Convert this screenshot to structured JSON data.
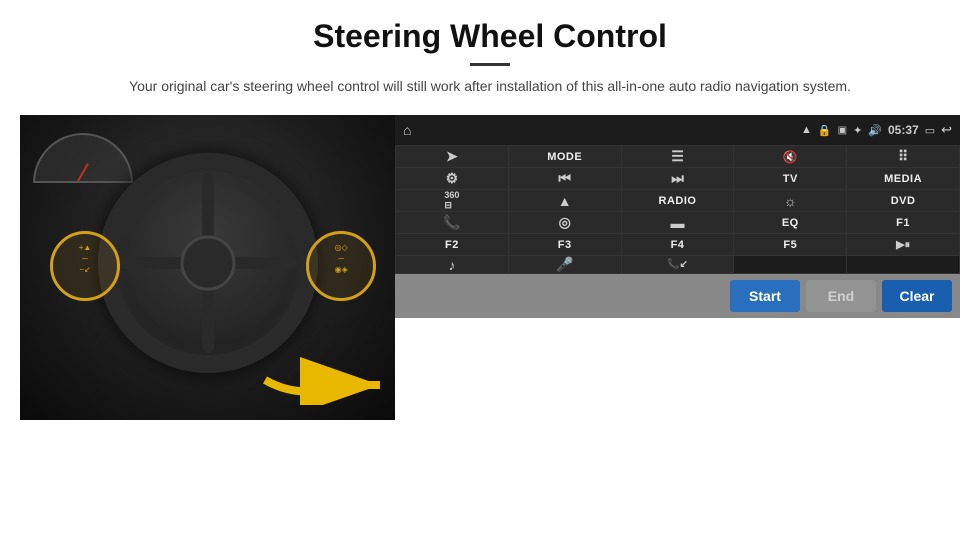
{
  "page": {
    "title": "Steering Wheel Control",
    "divider": true,
    "subtitle": "Your original car's steering wheel control will still work after installation of this all-in-one auto radio navigation system."
  },
  "android_ui": {
    "status_bar": {
      "time": "05:37",
      "icons": [
        "wifi",
        "lock",
        "sd-card",
        "bluetooth",
        "volume",
        "back",
        "home"
      ]
    },
    "grid_cells": [
      {
        "id": "r1c1",
        "type": "icon",
        "icon": "⊏",
        "label": "nav-icon"
      },
      {
        "id": "r1c2",
        "type": "text",
        "text": "MODE"
      },
      {
        "id": "r1c3",
        "type": "icon",
        "icon": "☰",
        "label": "list-icon"
      },
      {
        "id": "r1c4",
        "type": "icon",
        "icon": "🔇",
        "label": "mute-icon"
      },
      {
        "id": "r1c5",
        "type": "icon",
        "icon": "⠿",
        "label": "apps-icon"
      },
      {
        "id": "r2c1",
        "type": "icon",
        "icon": "⚙",
        "label": "settings-icon"
      },
      {
        "id": "r2c2",
        "type": "icon",
        "icon": "⏮",
        "label": "prev-icon"
      },
      {
        "id": "r2c3",
        "type": "icon",
        "icon": "⏭",
        "label": "next-icon"
      },
      {
        "id": "r2c4",
        "type": "text",
        "text": "TV"
      },
      {
        "id": "r2c5",
        "type": "text",
        "text": "MEDIA"
      },
      {
        "id": "r3c1",
        "type": "icon",
        "icon": "360",
        "label": "360-icon"
      },
      {
        "id": "r3c2",
        "type": "icon",
        "icon": "▲",
        "label": "eject-icon"
      },
      {
        "id": "r3c3",
        "type": "text",
        "text": "RADIO"
      },
      {
        "id": "r3c4",
        "type": "icon",
        "icon": "☼",
        "label": "brightness-icon"
      },
      {
        "id": "r3c5",
        "type": "text",
        "text": "DVD"
      },
      {
        "id": "r4c1",
        "type": "icon",
        "icon": "📞",
        "label": "phone-icon"
      },
      {
        "id": "r4c2",
        "type": "icon",
        "icon": "◎",
        "label": "compass-icon"
      },
      {
        "id": "r4c3",
        "type": "icon",
        "icon": "▭",
        "label": "screen-icon"
      },
      {
        "id": "r4c4",
        "type": "text",
        "text": "EQ"
      },
      {
        "id": "r4c5",
        "type": "text",
        "text": "F1"
      },
      {
        "id": "r5c1",
        "type": "text",
        "text": "F2"
      },
      {
        "id": "r5c2",
        "type": "text",
        "text": "F3"
      },
      {
        "id": "r5c3",
        "type": "text",
        "text": "F4"
      },
      {
        "id": "r5c4",
        "type": "text",
        "text": "F5"
      },
      {
        "id": "r5c5",
        "type": "icon",
        "icon": "▶⏸",
        "label": "play-pause-icon"
      },
      {
        "id": "r6c1",
        "type": "icon",
        "icon": "♪",
        "label": "music-icon"
      },
      {
        "id": "r6c2",
        "type": "icon",
        "icon": "🎤",
        "label": "mic-icon"
      },
      {
        "id": "r6c3",
        "type": "icon",
        "icon": "📞↙",
        "label": "call-icon"
      }
    ],
    "bottom_buttons": {
      "start": "Start",
      "end": "End",
      "clear": "Clear"
    }
  }
}
